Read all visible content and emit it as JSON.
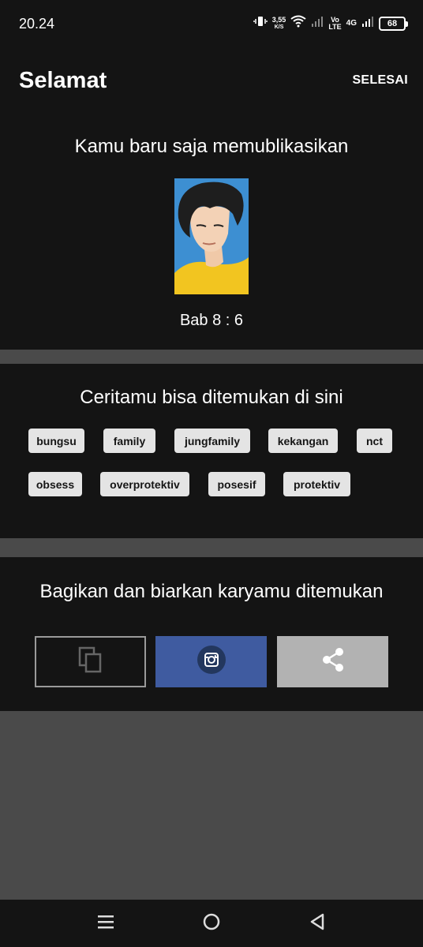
{
  "status_bar": {
    "time": "20.24",
    "net_speed_value": "3,55",
    "net_speed_unit": "K/S",
    "volte_top": "Vo",
    "volte_bottom": "LTE",
    "network": "4G",
    "battery": "68",
    "icons": [
      "vibrate-icon",
      "wifi-icon",
      "signal-icon",
      "battery-icon"
    ]
  },
  "header": {
    "title": "Selamat",
    "done_label": "SELESAI"
  },
  "published": {
    "heading": "Kamu baru saja memublikasikan",
    "chapter": "Bab 8 : 6"
  },
  "discover": {
    "heading": "Ceritamu bisa ditemukan di sini",
    "tags": [
      "bungsu",
      "family",
      "jungfamily",
      "kekangan",
      "nct",
      "obsess",
      "overprotektiv",
      "posesif",
      "protektiv"
    ]
  },
  "share": {
    "heading": "Bagikan dan biarkan karyamu ditemukan",
    "buttons": [
      "copy-icon",
      "instagram-icon",
      "share-icon"
    ]
  },
  "colors": {
    "background": "#141414",
    "separator": "#4a4a4a",
    "tag_bg": "#e4e4e4",
    "instagram": "#3f5ba0",
    "share_button": "#b2b2b2"
  }
}
